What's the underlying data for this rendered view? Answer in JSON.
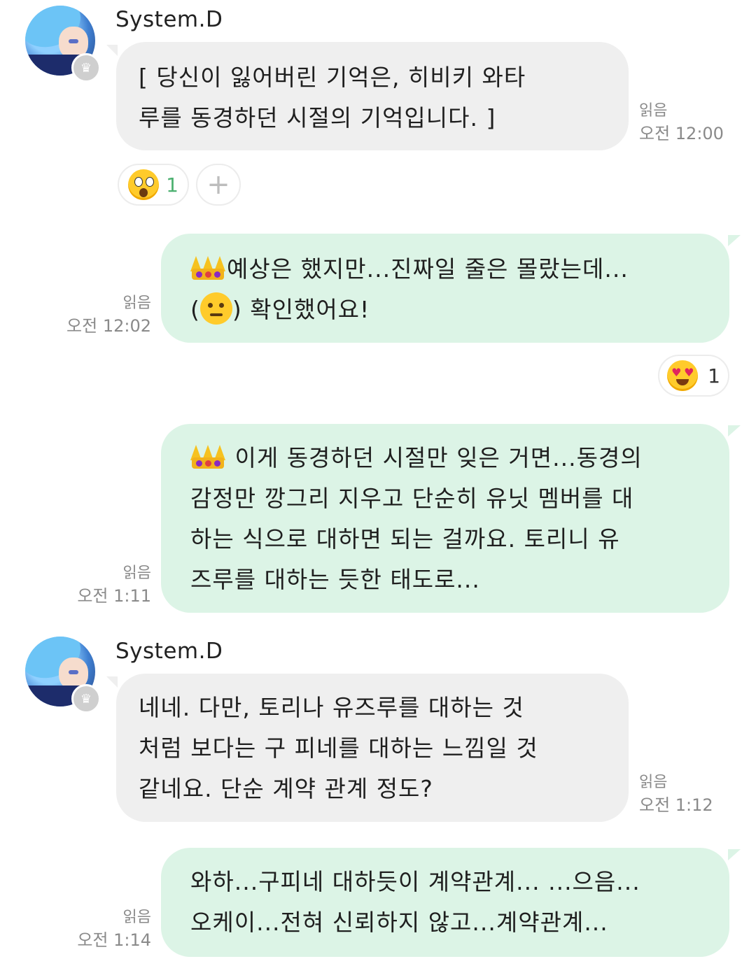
{
  "messages": {
    "m1": {
      "sender": "System.D",
      "lines": [
        "[ 당신이 잃어버린 기억은, 히비키 와타",
        "루를 동경하던 시절의 기억입니다. ]"
      ],
      "read": "읽음",
      "time": "오전 12:00",
      "reaction": {
        "emoji": "astonished-face",
        "count": "1"
      },
      "add_reaction": "+"
    },
    "m2": {
      "lines": [
        "예상은 했지만...진짜일 줄은 몰랐는데...",
        "(",
        ") 확인했어요!"
      ],
      "read": "읽음",
      "time": "오전 12:02",
      "reaction": {
        "emoji": "heart-eyes-face",
        "count": "1"
      }
    },
    "m3": {
      "lines": [
        " 이게 동경하던 시절만 잊은 거면...동경의",
        "감정만 깡그리 지우고 단순히 유닛 멤버를 대",
        "하는 식으로 대하면 되는 걸까요. 토리니 유",
        "즈루를 대하는 듯한 태도로..."
      ],
      "read": "읽음",
      "time": "오전 1:11"
    },
    "m4": {
      "sender": "System.D",
      "lines": [
        "네네. 다만, 토리나 유즈루를 대하는 것",
        "처럼 보다는 구 피네를 대하는 느낌일 것",
        "같네요. 단순 계약 관계 정도?"
      ],
      "read": "읽음",
      "time": "오전 1:12"
    },
    "m5": {
      "lines": [
        "와하...구피네 대하듯이 계약관계... ...으음...",
        "오케이...전혀 신뢰하지 않고...계약관계..."
      ],
      "read": "읽음",
      "time": "오전 1:14"
    }
  },
  "colors": {
    "incoming_bubble": "#efefef",
    "outgoing_bubble": "#dcf4e6",
    "meta_text": "#8a8a8a",
    "reaction_count": "#4cb070"
  },
  "icons": {
    "crown_badge": "crown-icon",
    "crown_emoji": "crown-emoji-icon",
    "thinking": "thinking-face-icon"
  }
}
